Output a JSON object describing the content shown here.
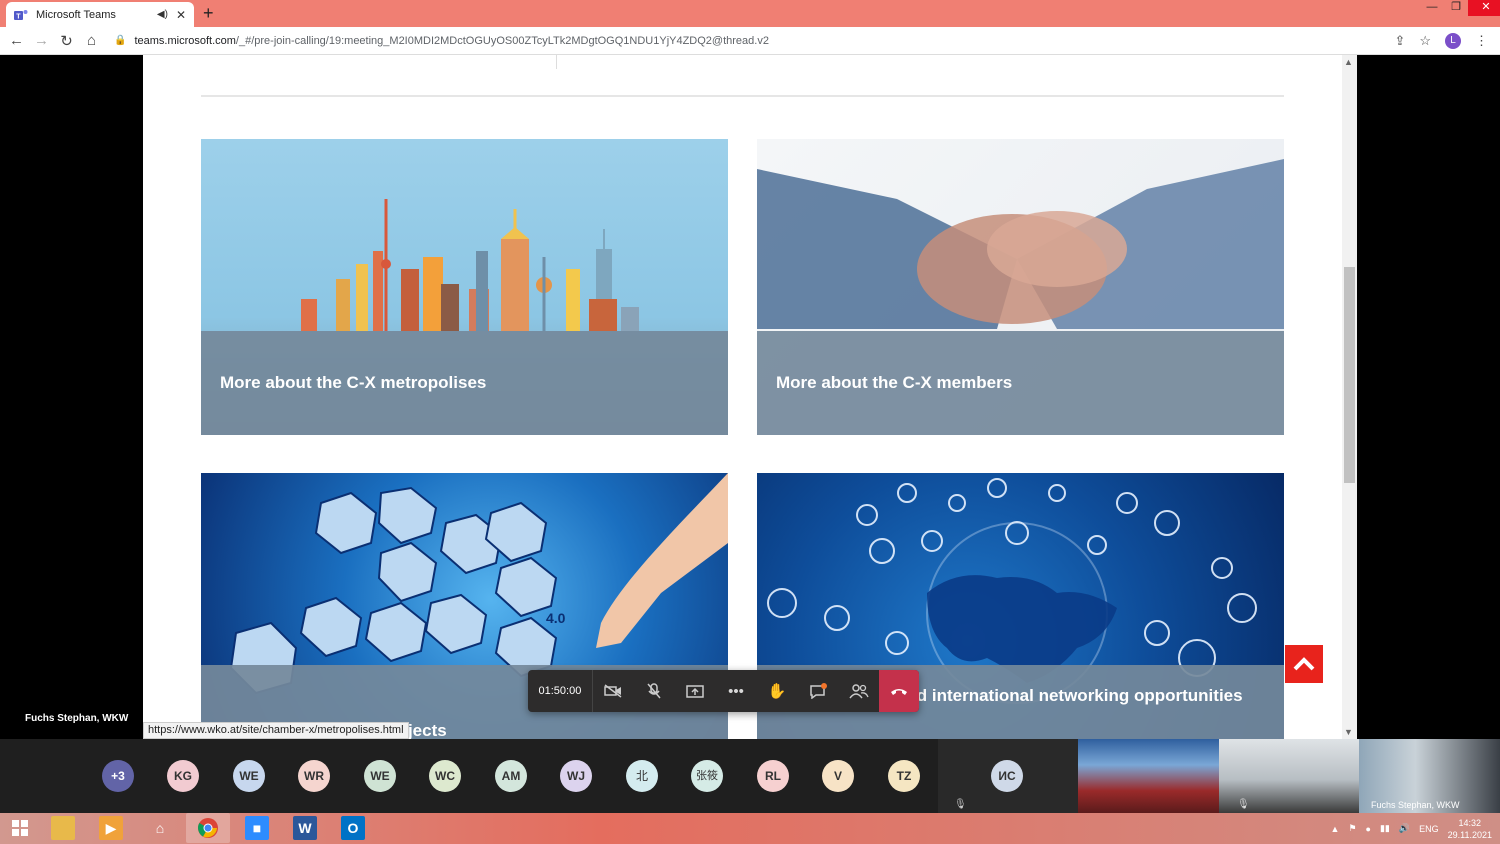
{
  "browser": {
    "tab_title": "Microsoft Teams",
    "url_host": "teams.microsoft.com",
    "url_path": "/_#/pre-join-calling/19:meeting_M2I0MDI2MDctOGUyOS00ZTcyLTk2MDgtOGQ1NDU1YjY4ZDQ2@thread.v2",
    "profile_initial": "L"
  },
  "cards": [
    {
      "caption": "More about the C-X metropolises"
    },
    {
      "caption": "More about the C-X members"
    },
    {
      "caption": "More about the C-X projects"
    },
    {
      "caption": "B2B platforms and international networking opportunities"
    }
  ],
  "status_link": "https://www.wko.at/site/chamber-x/metropolises.html",
  "meeting": {
    "timer": "01:50:00",
    "speaker_name": "Fuchs Stephan, WKW",
    "participants": [
      {
        "initials": "+3",
        "color": "#6264a7"
      },
      {
        "initials": "KG",
        "color": "#f2cbd1"
      },
      {
        "initials": "WE",
        "color": "#c7d7ee"
      },
      {
        "initials": "WR",
        "color": "#f5d5cf"
      },
      {
        "initials": "WE",
        "color": "#cfe3d4"
      },
      {
        "initials": "WC",
        "color": "#dde9cf"
      },
      {
        "initials": "AM",
        "color": "#d3e6dc"
      },
      {
        "initials": "WJ",
        "color": "#dcd3ee"
      },
      {
        "initials": "北",
        "color": "#d4ecef"
      },
      {
        "initials": "张筱",
        "color": "#d5ebe6"
      },
      {
        "initials": "RL",
        "color": "#f6d0d0"
      },
      {
        "initials": "V",
        "color": "#f7e3c6"
      },
      {
        "initials": "TZ",
        "color": "#f5e6c2"
      },
      {
        "initials": "ИС",
        "color": "#cfd9e8"
      }
    ],
    "video_name": "Fuchs Stephan, WKW"
  },
  "taskbar": {
    "lang": "ENG",
    "time": "14:32",
    "date": "29.11.2021"
  }
}
